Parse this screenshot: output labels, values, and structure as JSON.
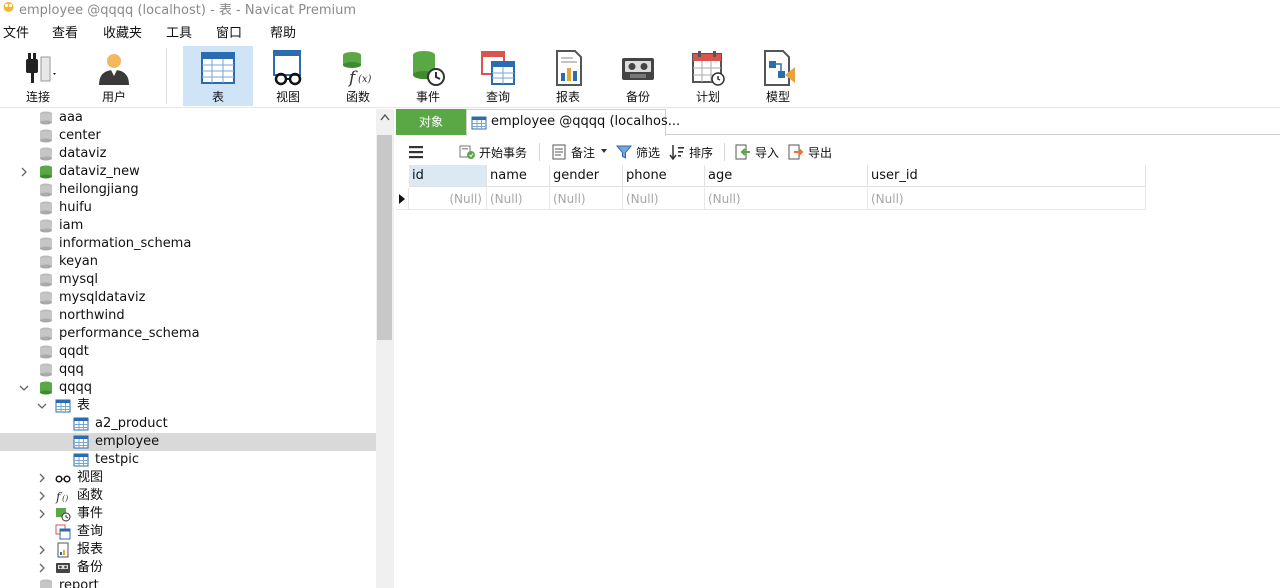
{
  "window": {
    "title": "employee @qqqq (localhost) - 表 - Navicat Premium"
  },
  "menu": [
    "文件",
    "查看",
    "收藏夹",
    "工具",
    "窗口",
    "帮助"
  ],
  "toolbar": {
    "connect": "连接",
    "user": "用户",
    "table": "表",
    "view": "视图",
    "function": "函数",
    "event": "事件",
    "query": "查询",
    "report": "报表",
    "backup": "备份",
    "schedule": "计划",
    "model": "模型"
  },
  "tree": {
    "databases": [
      "aaa",
      "center",
      "dataviz",
      "dataviz_new",
      "heilongjiang",
      "huifu",
      "iam",
      "information_schema",
      "keyan",
      "mysql",
      "mysqldataviz",
      "northwind",
      "performance_schema",
      "qqdt",
      "qqq",
      "qqqq"
    ],
    "tables_folder": "表",
    "tables": [
      "a2_product",
      "employee",
      "testpic"
    ],
    "groups": [
      "视图",
      "函数",
      "事件",
      "查询",
      "报表",
      "备份"
    ],
    "next_db": "report"
  },
  "tabs": {
    "objects": "对象",
    "editor": "employee @qqqq (localhos..."
  },
  "subtoolbar": {
    "begin_tx": "开始事务",
    "memo": "备注",
    "filter": "筛选",
    "sort": "排序",
    "import": "导入",
    "export": "导出"
  },
  "grid": {
    "columns": [
      "id",
      "name",
      "gender",
      "phone",
      "age",
      "user_id"
    ],
    "row": [
      "(Null)",
      "(Null)",
      "(Null)",
      "(Null)",
      "(Null)",
      "(Null)"
    ]
  },
  "colors": {
    "accent_green": "#5aa845",
    "selected_tool": "#cfe4f7",
    "selected_row": "#d9d9d9",
    "null_text": "#a6a6a6"
  }
}
